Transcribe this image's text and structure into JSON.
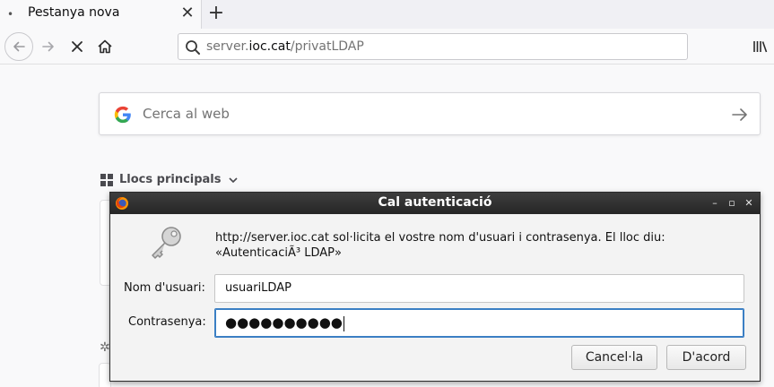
{
  "tab": {
    "title": "Pestanya nova",
    "dot": "•",
    "close": "✕"
  },
  "newtab": "+",
  "nav": {
    "back": "back-arrow-icon",
    "forward": "forward-arrow-icon",
    "stop": "stop-icon",
    "home": "home-icon",
    "library": "library-icon"
  },
  "urlbar": {
    "prefix": "server.",
    "host": "ioc.cat",
    "path": "/privatLDAP"
  },
  "search": {
    "placeholder": "Cerca al web"
  },
  "top_sites": {
    "label": "Llocs principals"
  },
  "dialog": {
    "title": "Cal autenticació",
    "message_line1": "http://server.ioc.cat sol·licita el vostre nom d'usuari i contrasenya. El lloc diu:",
    "message_line2": "«AutenticaciÃ³ LDAP»",
    "username_label": "Nom d'usuari:",
    "username_value": "usuariLDAP",
    "password_label": "Contrasenya:",
    "password_value": "●●●●●●●●●●",
    "cancel": "Cancel·la",
    "ok": "D'acord",
    "window_buttons": [
      "–",
      "▫",
      "✕"
    ]
  },
  "colors": {
    "focus": "#3b7fc4",
    "titlebar": "#2f2f2f"
  }
}
